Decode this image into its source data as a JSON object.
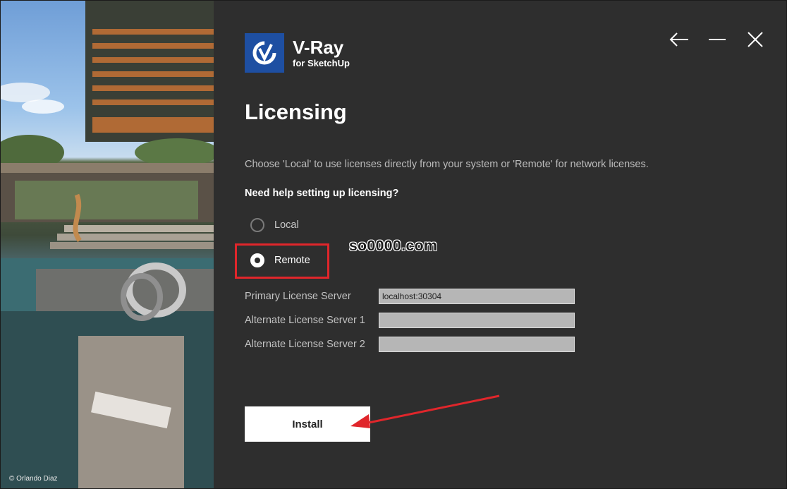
{
  "art": {
    "credit": "© Orlando Diaz"
  },
  "logo": {
    "name": "V-Ray",
    "subtitle": "for SketchUp"
  },
  "window_controls": [
    "back-arrow-icon",
    "minimize-icon",
    "close-icon"
  ],
  "title": "Licensing",
  "description": "Choose 'Local' to use licenses directly from your system or 'Remote' for network licenses.",
  "help_link": "Need help setting up licensing?",
  "options": {
    "local_label": "Local",
    "remote_label": "Remote",
    "selected": "Remote"
  },
  "watermark": "so0000.com",
  "fields": {
    "primary_label": "Primary License Server",
    "primary_value": "localhost:30304",
    "alt1_label": "Alternate License Server 1",
    "alt1_value": "",
    "alt2_label": "Alternate License Server 2",
    "alt2_value": ""
  },
  "install_label": "Install",
  "colors": {
    "background": "#2e2e2e",
    "accent": "#1e4fa2",
    "annotation_red": "#e0262b"
  }
}
